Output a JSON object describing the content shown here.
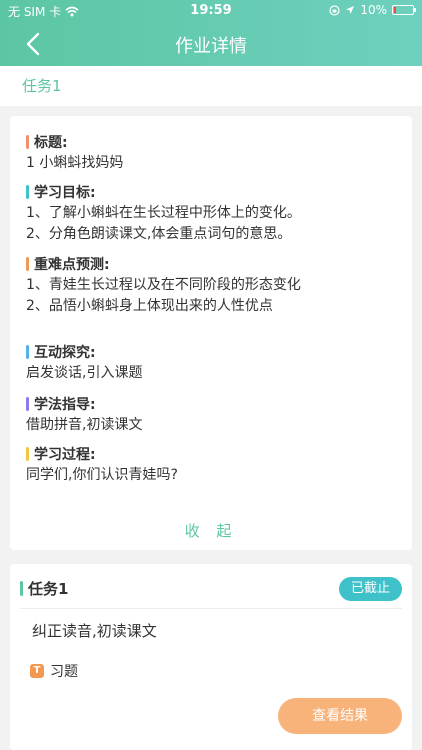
{
  "status_bar": {
    "carrier": "无 SIM 卡",
    "time": "19:59",
    "battery": "10%"
  },
  "nav": {
    "title": "作业详情"
  },
  "task_tab": {
    "label": "任务1"
  },
  "detail": {
    "sections": [
      {
        "heading": "标题:",
        "color": "#f0926e",
        "lines": [
          "1 小蝌蚪找妈妈"
        ]
      },
      {
        "heading": "学习目标:",
        "color": "#3ec1c9",
        "lines": [
          "1、了解小蝌蚪在生长过程中形体上的变化。",
          "2、分角色朗读课文,体会重点词句的意思。"
        ]
      },
      {
        "heading": "重难点预测:",
        "color": "#f19953",
        "lines": [
          "1、青娃生长过程以及在不同阶段的形态变化",
          "2、品悟小蝌蚪身上体现出来的人性优点"
        ]
      },
      {
        "heading": "互动探究:",
        "color": "#4fb3e8",
        "lines": [
          "启发谈话,引入课题"
        ]
      },
      {
        "heading": "学法指导:",
        "color": "#8f7bea",
        "lines": [
          "借助拼音,初读课文"
        ]
      },
      {
        "heading": "学习过程:",
        "color": "#f0c73e",
        "lines": [
          "同学们,你们认识青娃吗?"
        ]
      }
    ],
    "collapse_label": "收 起"
  },
  "task_card": {
    "title": "任务1",
    "status": "已截止",
    "description": "纠正读音,初读课文",
    "exercise_icon_letter": "T",
    "exercise_label": "习题",
    "result_button": "查看结果"
  },
  "colors": {
    "accent": "#5cc6a4",
    "badge": "#3ec1c9",
    "result_button": "#f7b37a",
    "exercise_icon": "#f19953"
  }
}
